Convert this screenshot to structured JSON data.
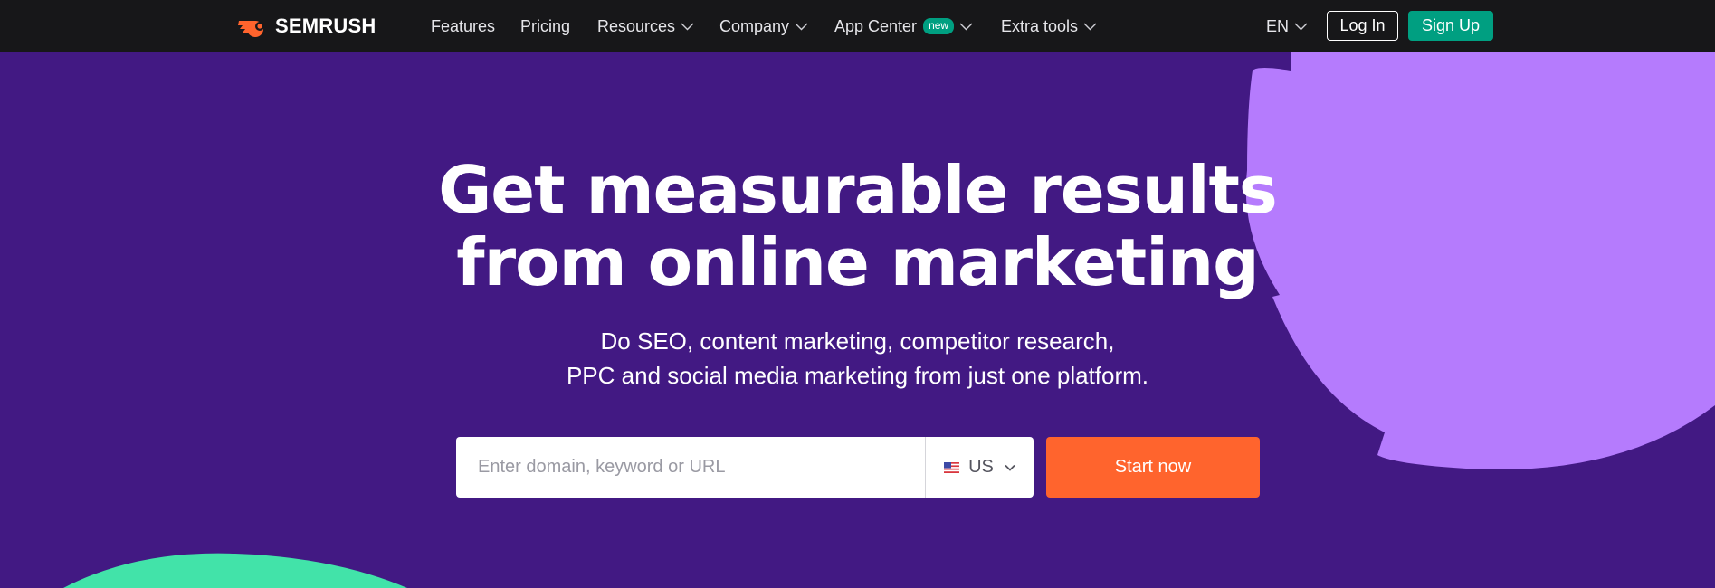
{
  "brand": {
    "name": "SEMRUSH",
    "accent": "#ff642d"
  },
  "nav": {
    "items": [
      {
        "label": "Features",
        "dropdown": false
      },
      {
        "label": "Pricing",
        "dropdown": false
      },
      {
        "label": "Resources",
        "dropdown": true
      },
      {
        "label": "Company",
        "dropdown": true
      },
      {
        "label": "App Center",
        "badge": "new",
        "dropdown": true
      },
      {
        "label": "Extra tools",
        "dropdown": true
      }
    ],
    "language": "EN",
    "login_label": "Log In",
    "signup_label": "Sign Up"
  },
  "hero": {
    "headline_line1": "Get measurable results",
    "headline_line2": "from online marketing",
    "subline_line1": "Do SEO, content marketing, competitor research,",
    "subline_line2": "PPC and social media marketing from just one platform."
  },
  "search": {
    "placeholder": "Enter domain, keyword or URL",
    "value": "",
    "database": "US",
    "flag_icon": "us-flag-icon",
    "submit_label": "Start now"
  },
  "colors": {
    "background": "#421983",
    "topbar": "#171719",
    "signup": "#009f81",
    "start_button": "#ff642d",
    "blob_purple": "#b57bfd",
    "blob_green": "#42e3a9"
  }
}
